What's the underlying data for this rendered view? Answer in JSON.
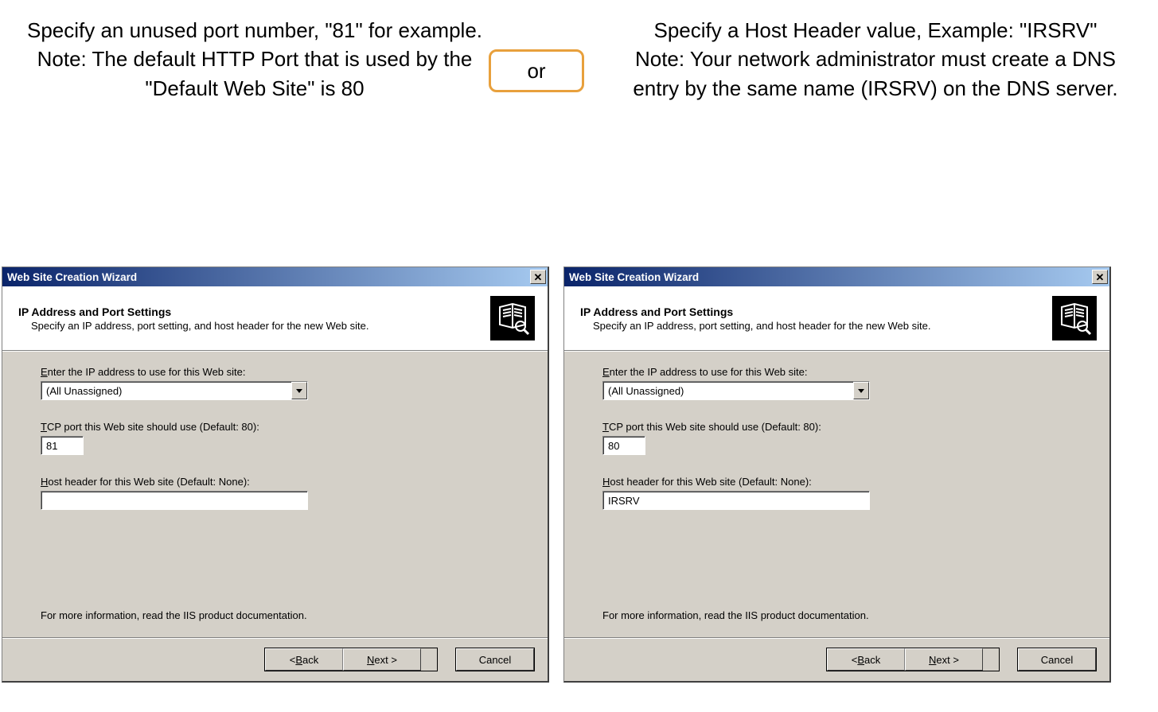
{
  "annotations": {
    "left": "Specify an unused port number, \"81\" for example.\nNote: The default HTTP Port that is used by the \"Default Web Site\" is 80",
    "or": "or",
    "right": "Specify a Host Header value, Example: \"IRSRV\"\nNote: Your network administrator must create a DNS entry by the same name (IRSRV) on the DNS server."
  },
  "wizard": {
    "title": "Web Site Creation Wizard",
    "heading": "IP Address and Port Settings",
    "subheading": "Specify an IP address, port setting, and host header for the new Web site.",
    "labels": {
      "ip_first": "E",
      "ip_rest": "nter the IP address to use for this Web site:",
      "port_first": "T",
      "port_rest": "CP port this Web site should use (Default: 80):",
      "host_first": "H",
      "host_rest": "ost header for this Web site (Default: None):"
    },
    "footer": "For more information, read the IIS product documentation.",
    "buttons": {
      "back_lt": "< ",
      "back_first": "B",
      "back_rest": "ack",
      "next_first": "N",
      "next_rest": "ext >",
      "cancel": "Cancel"
    }
  },
  "left_window": {
    "ip": "(All Unassigned)",
    "port": "81",
    "host": ""
  },
  "right_window": {
    "ip": "(All Unassigned)",
    "port": "80",
    "host": "IRSRV"
  }
}
